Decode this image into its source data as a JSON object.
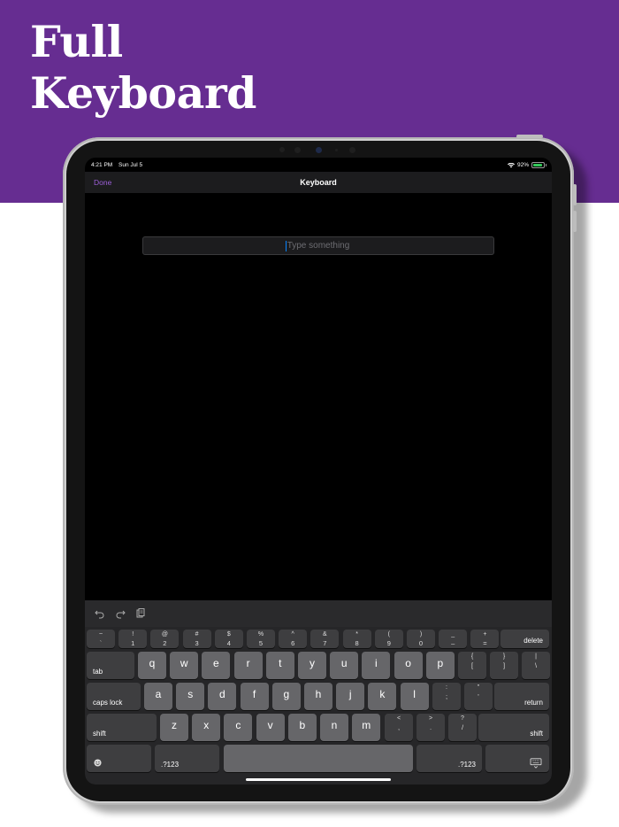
{
  "banner": {
    "title_line1": "Full",
    "title_line2": "Keyboard",
    "color": "#662d91"
  },
  "status_bar": {
    "time": "4:21 PM",
    "date": "Sun Jul 5",
    "battery_pct": "92%",
    "battery_fraction": 0.92,
    "wifi_icon": "wifi-icon"
  },
  "nav": {
    "done_label": "Done",
    "title": "Keyboard",
    "accent": "#9c5fd8"
  },
  "text_field": {
    "placeholder": "Type something",
    "value": ""
  },
  "assistant_bar": {
    "icons": [
      "undo-icon",
      "redo-icon",
      "paste-icon"
    ]
  },
  "keyboard": {
    "row1": [
      {
        "top": "~",
        "bot": "`"
      },
      {
        "top": "!",
        "bot": "1"
      },
      {
        "top": "@",
        "bot": "2"
      },
      {
        "top": "#",
        "bot": "3"
      },
      {
        "top": "$",
        "bot": "4"
      },
      {
        "top": "%",
        "bot": "5"
      },
      {
        "top": "^",
        "bot": "6"
      },
      {
        "top": "&",
        "bot": "7"
      },
      {
        "top": "*",
        "bot": "8"
      },
      {
        "top": "(",
        "bot": "9"
      },
      {
        "top": ")",
        "bot": "0"
      },
      {
        "top": "_",
        "bot": "–"
      },
      {
        "top": "+",
        "bot": "="
      }
    ],
    "delete_label": "delete",
    "tab_label": "tab",
    "row2": [
      "q",
      "w",
      "e",
      "r",
      "t",
      "y",
      "u",
      "i",
      "o",
      "p"
    ],
    "row2_punct": [
      {
        "top": "{",
        "bot": "["
      },
      {
        "top": "}",
        "bot": "]"
      },
      {
        "top": "|",
        "bot": "\\"
      }
    ],
    "caps_label": "caps lock",
    "row3": [
      "a",
      "s",
      "d",
      "f",
      "g",
      "h",
      "j",
      "k",
      "l"
    ],
    "row3_punct": [
      {
        "top": ":",
        "bot": ";"
      },
      {
        "top": "\"",
        "bot": "'"
      }
    ],
    "return_label": "return",
    "shift_left_label": "shift",
    "row4": [
      "z",
      "x",
      "c",
      "v",
      "b",
      "n",
      "m"
    ],
    "row4_punct": [
      {
        "top": "<",
        "bot": ","
      },
      {
        "top": ">",
        "bot": "."
      },
      {
        "top": "?",
        "bot": "/"
      }
    ],
    "shift_right_label": "shift",
    "emoji_icon": "emoji-icon",
    "numbers_left_label": ".?123",
    "numbers_right_label": ".?123",
    "dismiss_icon": "keyboard-dismiss-icon"
  }
}
